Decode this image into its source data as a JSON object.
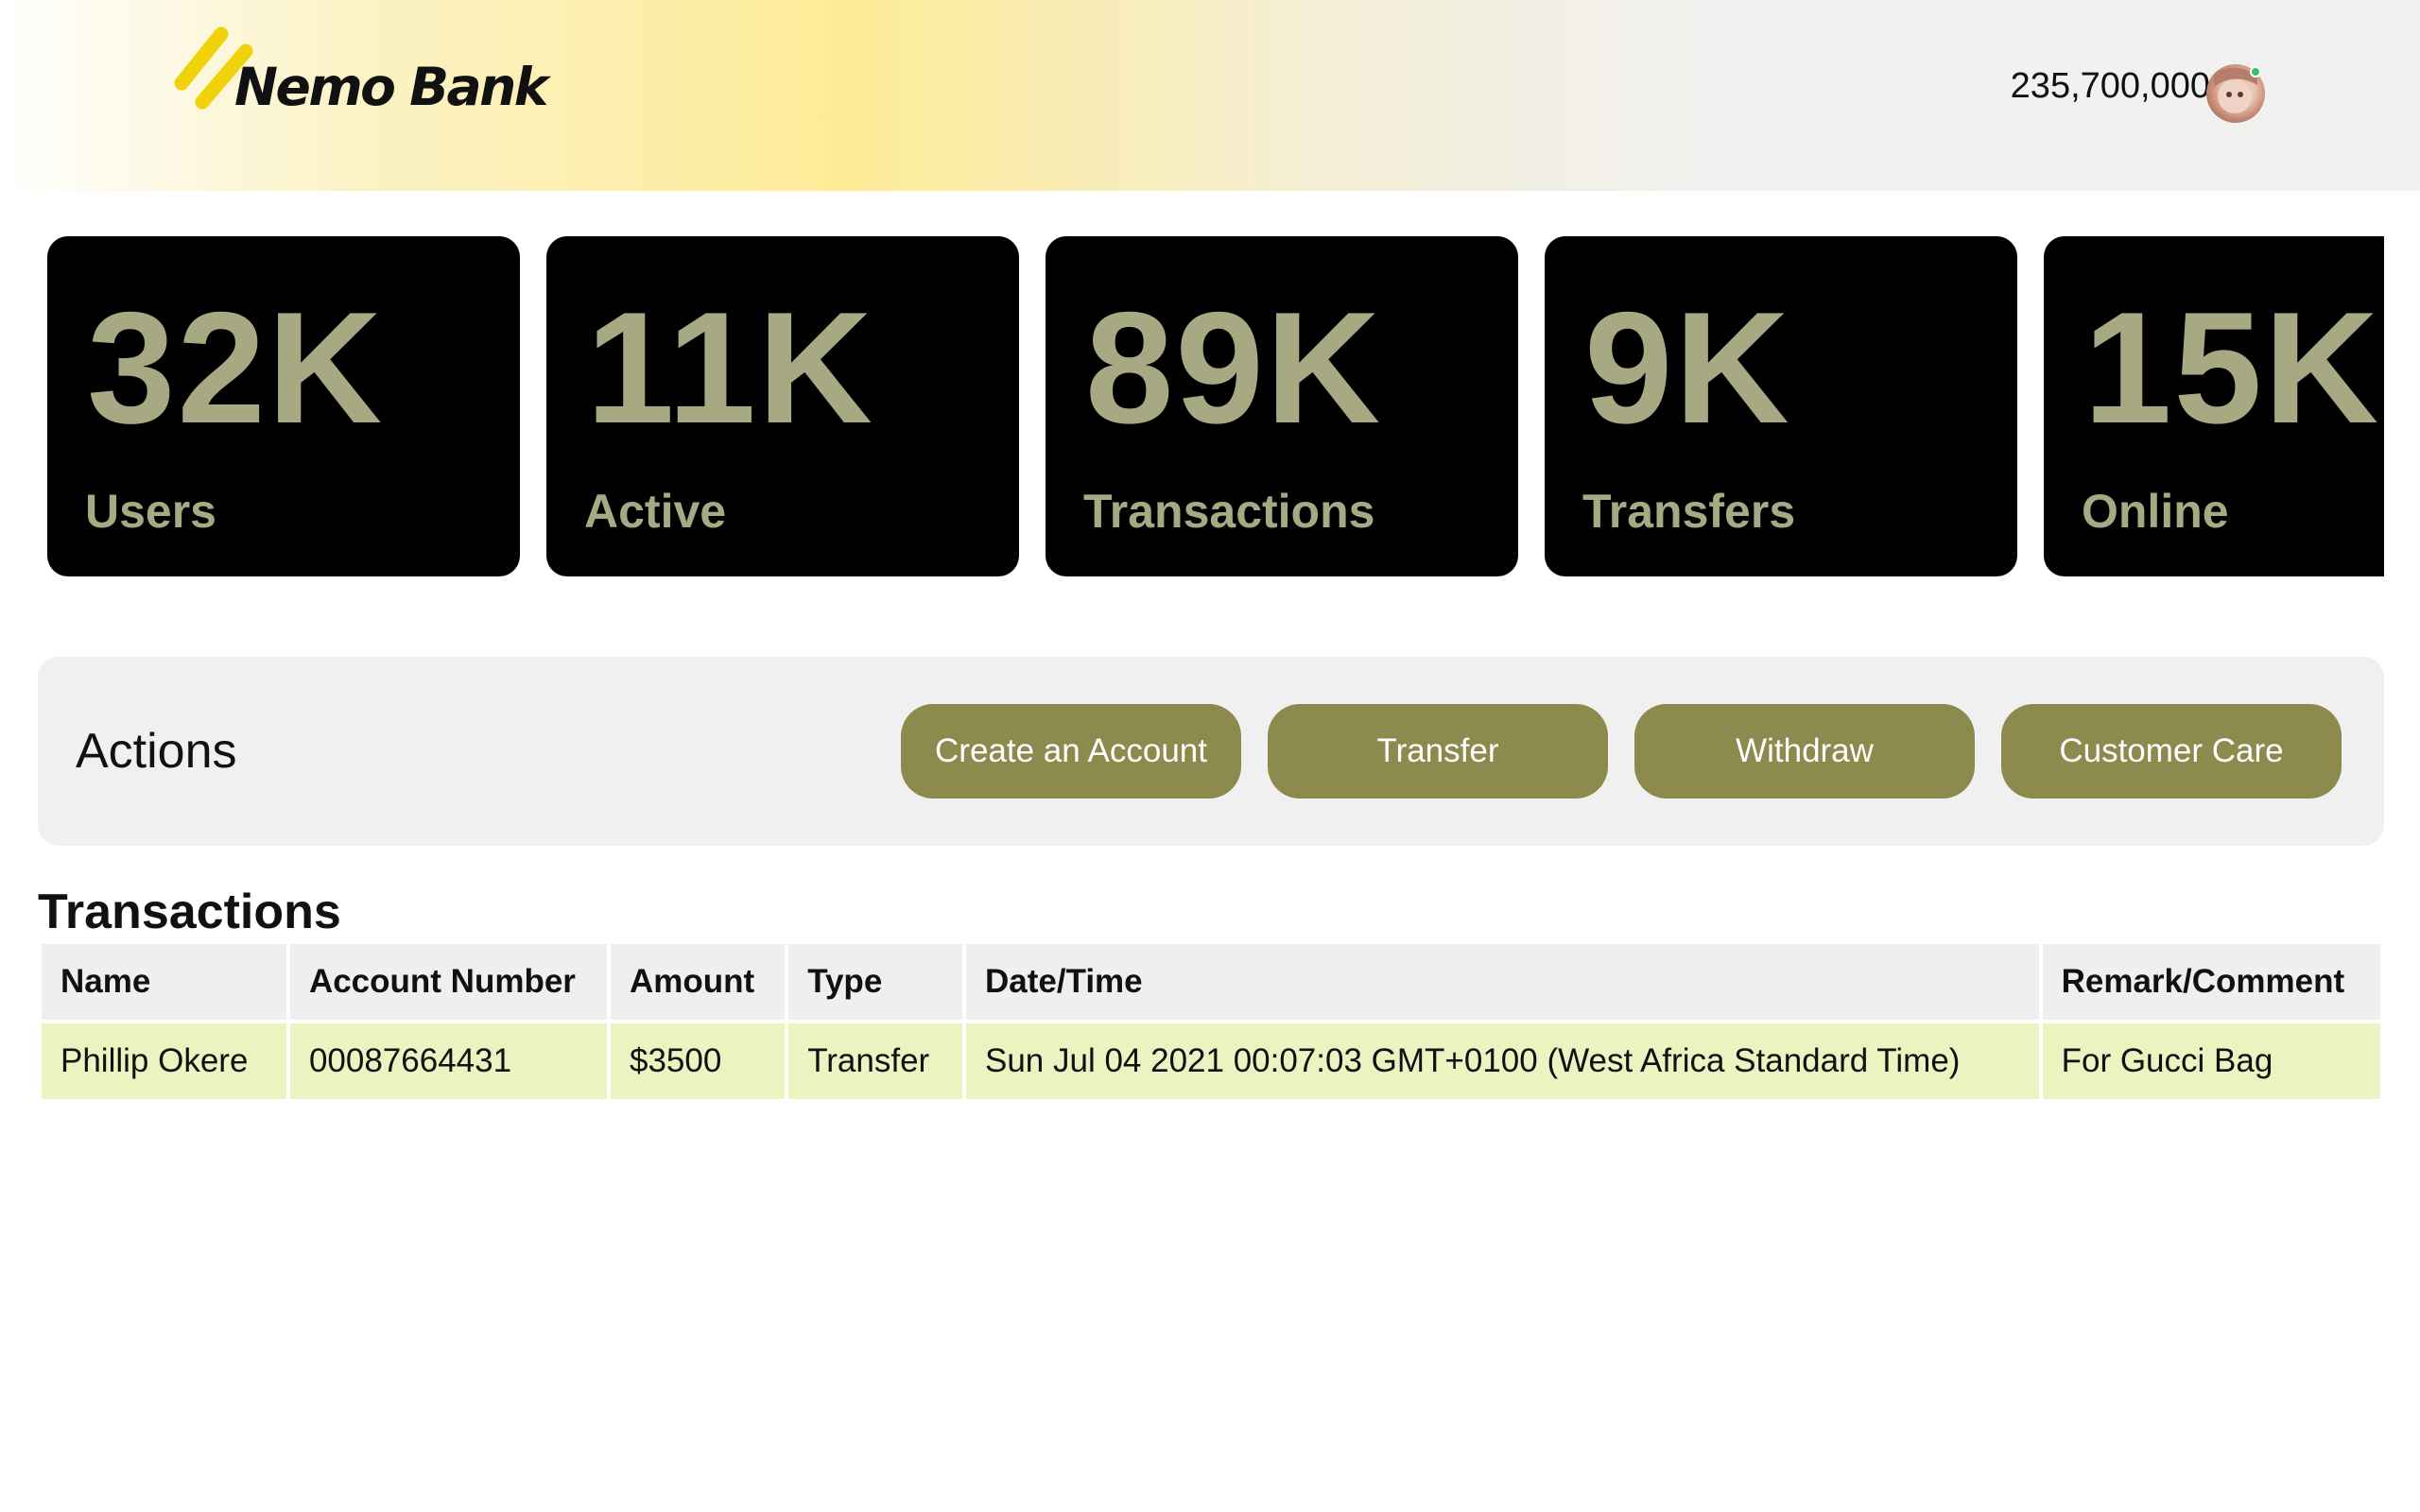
{
  "header": {
    "brand": "Nemo Bank",
    "balance": "235,700,000",
    "accent_color": "#fdeb96"
  },
  "stats": [
    {
      "value": "32K",
      "label": "Users"
    },
    {
      "value": "11K",
      "label": "Active"
    },
    {
      "value": "89K",
      "label": "Transactions"
    },
    {
      "value": "9K",
      "label": "Transfers"
    },
    {
      "value": "15K",
      "label": "Online"
    }
  ],
  "actions": {
    "title": "Actions",
    "buttons": [
      "Create an Account",
      "Transfer",
      "Withdraw",
      "Customer Care"
    ]
  },
  "transactions": {
    "title": "Transactions",
    "columns": [
      "Name",
      "Account Number",
      "Amount",
      "Type",
      "Date/Time",
      "Remark/Comment"
    ],
    "rows": [
      [
        "Phillip Okere",
        "00087664431",
        "$3500",
        "Transfer",
        "Sun Jul 04 2021 00:07:03 GMT+0100 (West Africa Standard Time)",
        "For Gucci Bag"
      ]
    ]
  },
  "colors": {
    "stat_text": "#a7a983",
    "button_bg": "#8c8a4c",
    "row_bg": "#e9f4c0"
  }
}
